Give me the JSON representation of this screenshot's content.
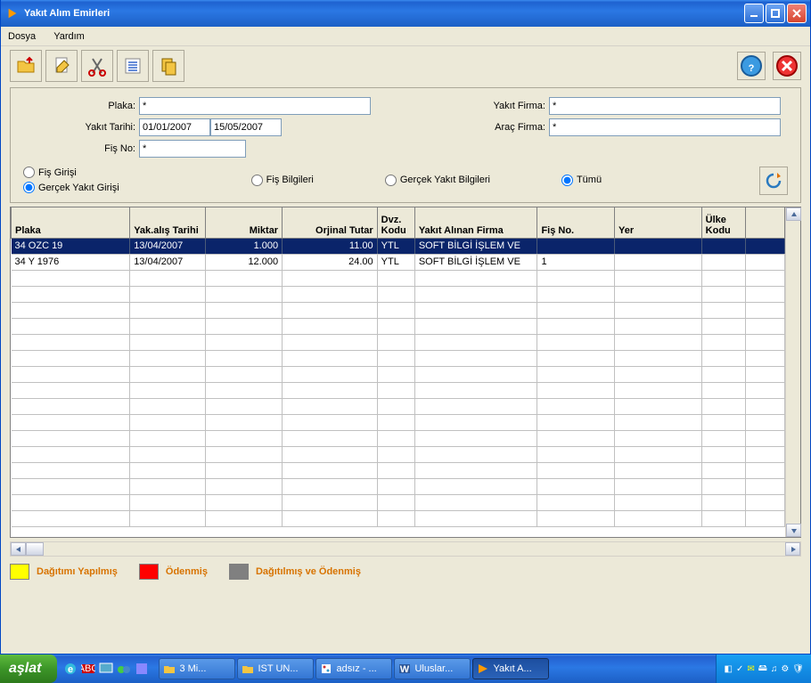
{
  "window": {
    "title": "Yakıt Alım Emirleri"
  },
  "menu": {
    "file": "Dosya",
    "help": "Yardım"
  },
  "form": {
    "plaka_label": "Plaka:",
    "plaka_value": "*",
    "yakit_tarihi_label": "Yakıt Tarihi:",
    "date_from": "01/01/2007",
    "date_to": "15/05/2007",
    "fis_no_label": "Fiş No:",
    "fis_no_value": "*",
    "yakit_firma_label": "Yakıt Firma:",
    "yakit_firma_value": "*",
    "arac_firma_label": "Araç Firma:",
    "arac_firma_value": "*"
  },
  "radios": {
    "fis_girisi": "Fiş Girişi",
    "gercek_yakit_girisi": "Gerçek Yakıt Girişi",
    "fis_bilgileri": "Fiş Bilgileri",
    "gercek_yakit_bilgileri": "Gerçek Yakıt Bilgileri",
    "tumu": "Tümü"
  },
  "grid": {
    "headers": {
      "plaka": "Plaka",
      "yak_alis_tarihi": "Yak.alış Tarihi",
      "miktar": "Miktar",
      "orjinal_tutar": "Orjinal Tutar",
      "dvz_kodu": "Dvz. Kodu",
      "yakit_alinan_firma": "Yakıt Alınan Firma",
      "fis_no": "Fiş No.",
      "yer": "Yer",
      "ulke_kodu": "Ülke Kodu"
    },
    "rows": [
      {
        "plaka": "34 OZC 19",
        "tarih": "13/04/2007",
        "miktar": "1.000",
        "tutar": "11.00",
        "dvz": "YTL",
        "firma": "SOFT BİLGİ İŞLEM VE",
        "fis": "",
        "yer": "",
        "ulke": ""
      },
      {
        "plaka": "34 Y 1976",
        "tarih": "13/04/2007",
        "miktar": "12.000",
        "tutar": "24.00",
        "dvz": "YTL",
        "firma": "SOFT BİLGİ İŞLEM VE",
        "fis": "1",
        "yer": "",
        "ulke": ""
      }
    ]
  },
  "legend": {
    "dagitimi_yapilmis": "Dağıtımı Yapılmış",
    "odenmis": "Ödenmiş",
    "dagitilmis_ve_odenmis": "Dağıtılmış ve Ödenmiş",
    "colors": {
      "yellow": "#ffff00",
      "red": "#ff0000",
      "gray": "#808080"
    }
  },
  "taskbar": {
    "start": "aşlat",
    "tasks": [
      {
        "label": "3 Mi...",
        "icon": "folder"
      },
      {
        "label": "IST UN...",
        "icon": "folder"
      },
      {
        "label": "adsız - ...",
        "icon": "paint"
      },
      {
        "label": "Uluslar...",
        "icon": "word"
      },
      {
        "label": "Yakıt A...",
        "icon": "app",
        "active": true
      }
    ]
  }
}
